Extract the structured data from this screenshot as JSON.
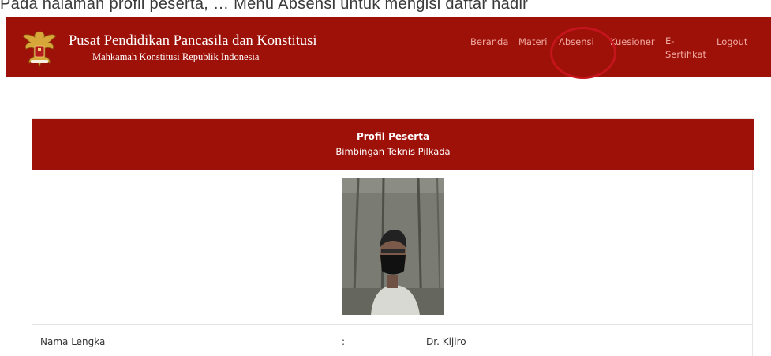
{
  "top_strip": {
    "partial_text": "Pada halaman profil peserta, … Menu Absensi untuk mengisi daftar hadir"
  },
  "header": {
    "title": "Pusat Pendidikan Pancasila dan Konstitusi",
    "subtitle": "Mahkamah Konstitusi Republik Indonesia",
    "logo_icon": "garuda-emblem-icon"
  },
  "nav": {
    "items": [
      {
        "label": "Beranda"
      },
      {
        "label": "Materi"
      },
      {
        "label": "Absensi"
      },
      {
        "label": "Kuesioner"
      },
      {
        "label": "E-Sertifikat"
      },
      {
        "label": "Logout"
      }
    ],
    "highlighted": "Absensi"
  },
  "profile": {
    "title": "Profil Peserta",
    "subtitle": "Bimbingan Teknis Pilkada",
    "photo_icon": "participant-photo",
    "rows": [
      {
        "label": "Nama Lengka",
        "separator": ":",
        "value": "Dr. Kijiro"
      }
    ]
  },
  "colors": {
    "brand_red": "#9e1109",
    "nav_link": "#f0a9a0",
    "annotation_circle": "#c4151c"
  }
}
